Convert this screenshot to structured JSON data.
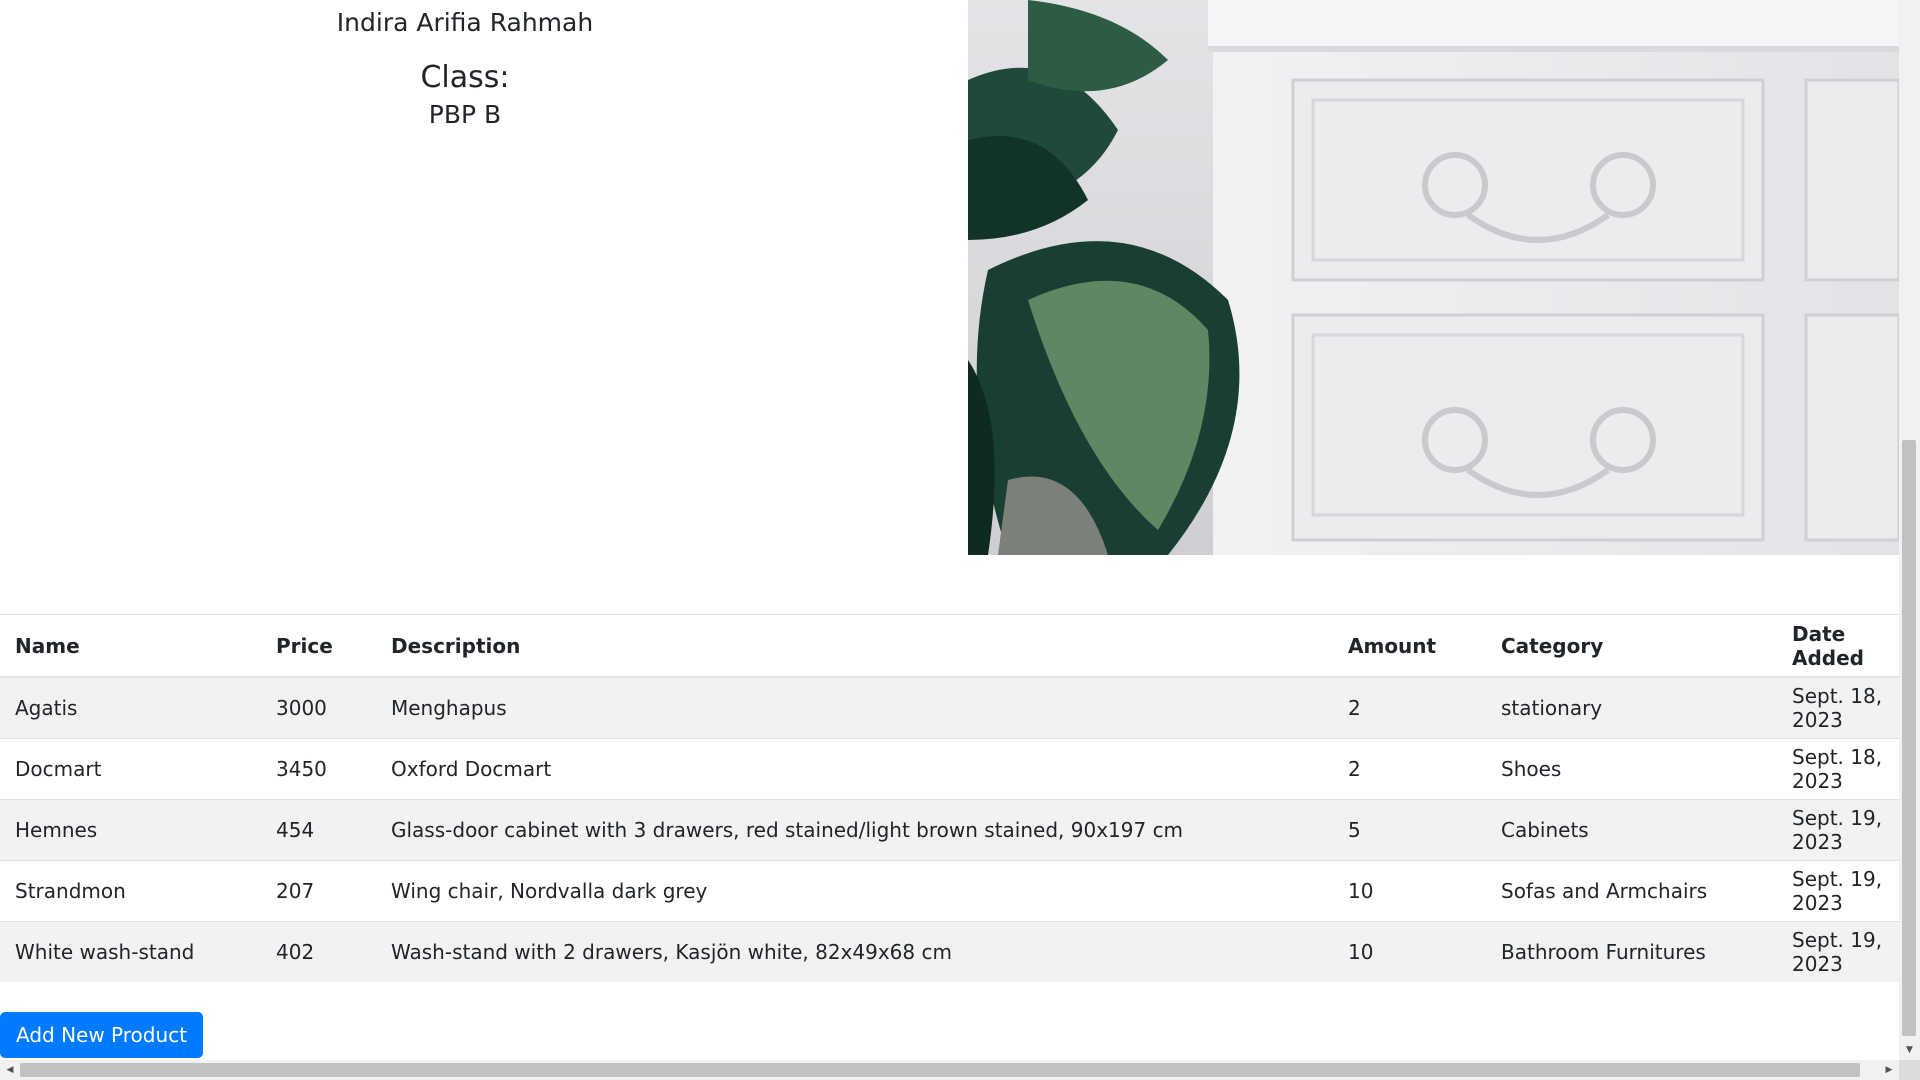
{
  "profile": {
    "name": "Indira Arifia Rahmah",
    "class_label": "Class:",
    "class_value": "PBP B"
  },
  "hero_image": {
    "alt": "white dresser with plant"
  },
  "table": {
    "headers": [
      "Name",
      "Price",
      "Description",
      "Amount",
      "Category",
      "Date Added"
    ],
    "rows": [
      {
        "name": "Agatis",
        "price": "3000",
        "description": "Menghapus",
        "amount": "2",
        "category": "stationary",
        "date_added": "Sept. 18, 2023"
      },
      {
        "name": "Docmart",
        "price": "3450",
        "description": "Oxford Docmart",
        "amount": "2",
        "category": "Shoes",
        "date_added": "Sept. 18, 2023"
      },
      {
        "name": "Hemnes",
        "price": "454",
        "description": "Glass-door cabinet with 3 drawers, red stained/light brown stained, 90x197 cm",
        "amount": "5",
        "category": "Cabinets",
        "date_added": "Sept. 19, 2023"
      },
      {
        "name": "Strandmon",
        "price": "207",
        "description": "Wing chair, Nordvalla dark grey",
        "amount": "10",
        "category": "Sofas and Armchairs",
        "date_added": "Sept. 19, 2023"
      },
      {
        "name": "White wash-stand",
        "price": "402",
        "description": "Wash-stand with 2 drawers, Kasjön white, 82x49x68 cm",
        "amount": "10",
        "category": "Bathroom Furnitures",
        "date_added": "Sept. 19, 2023"
      }
    ]
  },
  "actions": {
    "add_label": "Add New Product"
  },
  "colors": {
    "primary": "#007bff",
    "stripe": "#f2f2f2",
    "border": "#dee2e6"
  },
  "icons": {
    "scroll_up": "caret-up-icon",
    "scroll_down": "caret-down-icon",
    "scroll_left": "caret-left-icon",
    "scroll_right": "caret-right-icon"
  }
}
